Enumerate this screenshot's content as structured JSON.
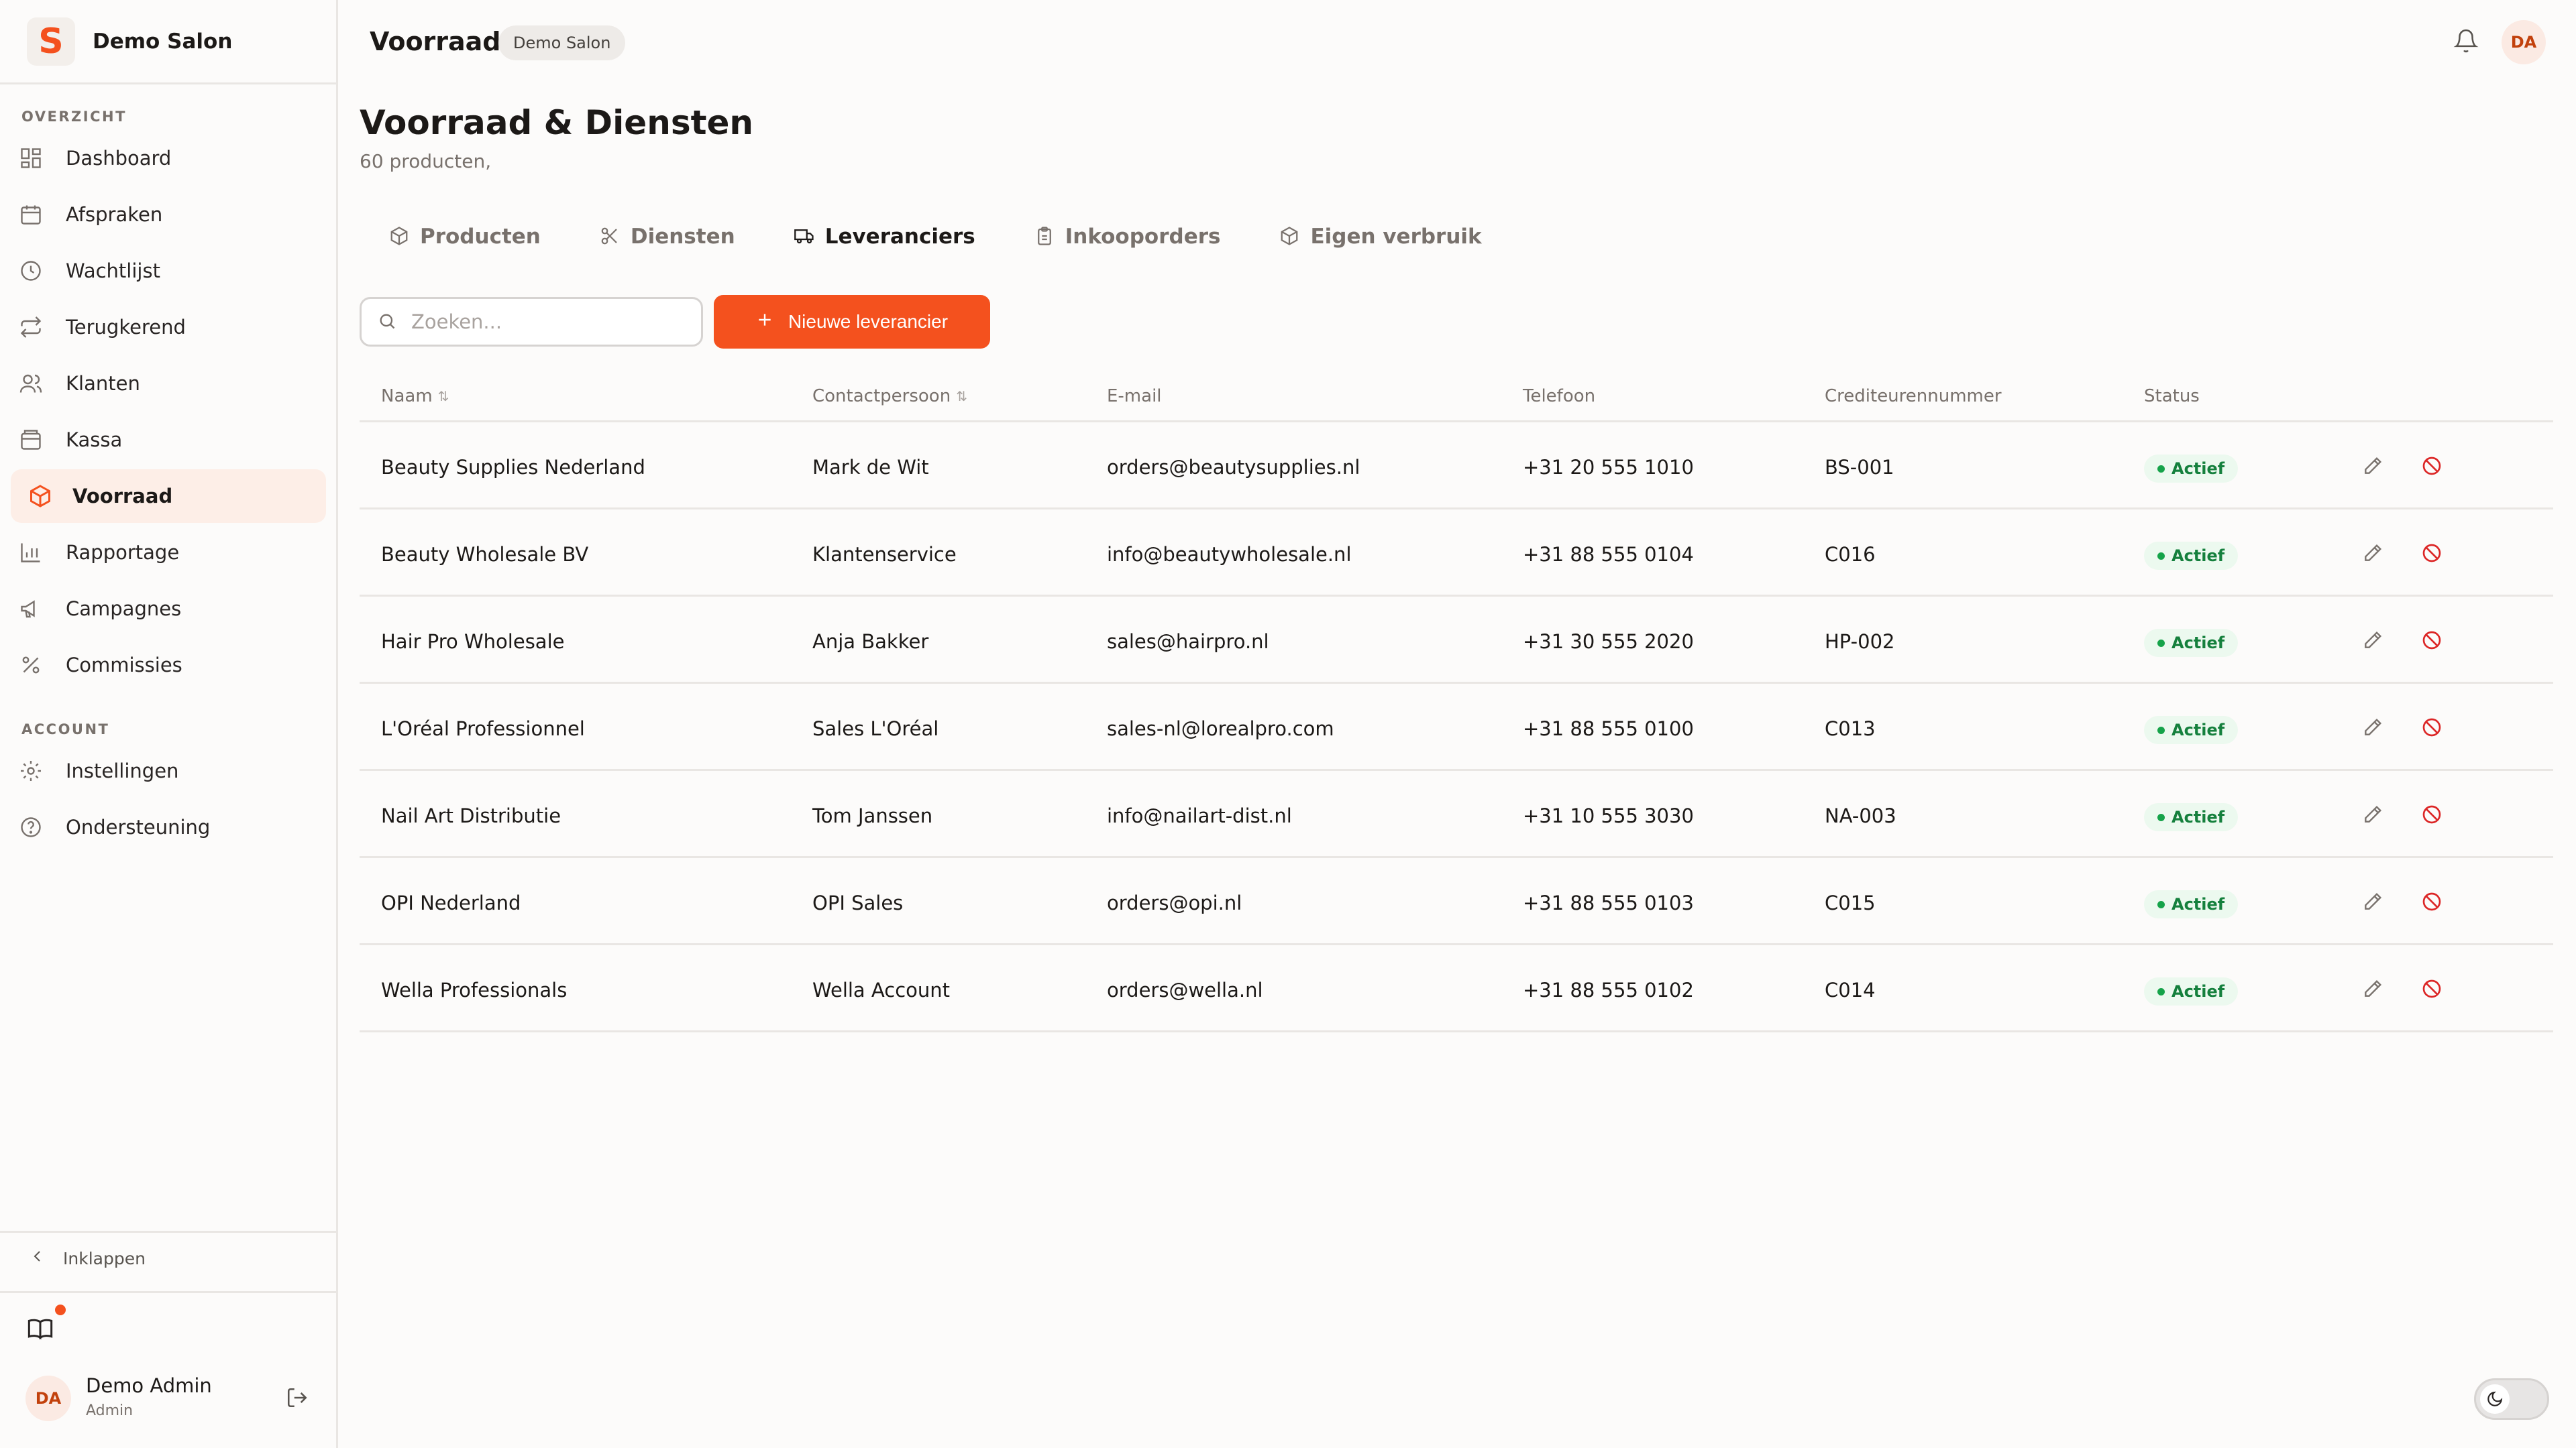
{
  "brand": {
    "logo_letter": "S",
    "name": "Demo Salon",
    "accent": "#f4511e"
  },
  "sidebar": {
    "section_overview": "OVERZICHT",
    "section_account": "ACCOUNT",
    "items": [
      {
        "label": "Dashboard",
        "icon": "dashboard-icon"
      },
      {
        "label": "Afspraken",
        "icon": "calendar-icon"
      },
      {
        "label": "Wachtlijst",
        "icon": "clock-icon"
      },
      {
        "label": "Terugkerend",
        "icon": "repeat-icon"
      },
      {
        "label": "Klanten",
        "icon": "users-icon"
      },
      {
        "label": "Kassa",
        "icon": "register-icon"
      },
      {
        "label": "Voorraad",
        "icon": "package-icon",
        "active": true
      },
      {
        "label": "Rapportage",
        "icon": "bar-chart-icon"
      },
      {
        "label": "Campagnes",
        "icon": "megaphone-icon"
      },
      {
        "label": "Commissies",
        "icon": "percent-icon"
      }
    ],
    "account_items": [
      {
        "label": "Instellingen",
        "icon": "gear-icon"
      },
      {
        "label": "Ondersteuning",
        "icon": "help-icon"
      }
    ],
    "collapse_label": "Inklappen",
    "user": {
      "initials": "DA",
      "name": "Demo Admin",
      "role": "Admin"
    }
  },
  "header": {
    "title": "Voorraad",
    "badge": "Demo Salon",
    "avatar_initials": "DA"
  },
  "page": {
    "title": "Voorraad & Diensten",
    "subtitle": "60 producten,"
  },
  "tabs": [
    {
      "label": "Producten",
      "icon": "box-icon"
    },
    {
      "label": "Diensten",
      "icon": "scissors-icon"
    },
    {
      "label": "Leveranciers",
      "icon": "truck-icon",
      "active": true
    },
    {
      "label": "Inkooporders",
      "icon": "clipboard-icon"
    },
    {
      "label": "Eigen verbruik",
      "icon": "box-icon"
    }
  ],
  "search": {
    "placeholder": "Zoeken...",
    "value": ""
  },
  "actions": {
    "new_supplier": "Nieuwe leverancier"
  },
  "table": {
    "columns": [
      "Naam",
      "Contactpersoon",
      "E-mail",
      "Telefoon",
      "Crediteurennummer",
      "Status"
    ],
    "rows": [
      {
        "name": "Beauty Supplies Nederland",
        "contact": "Mark de Wit",
        "email": "orders@beautysupplies.nl",
        "phone": "+31 20 555 1010",
        "creditor": "BS-001",
        "status": "Actief"
      },
      {
        "name": "Beauty Wholesale BV",
        "contact": "Klantenservice",
        "email": "info@beautywholesale.nl",
        "phone": "+31 88 555 0104",
        "creditor": "C016",
        "status": "Actief"
      },
      {
        "name": "Hair Pro Wholesale",
        "contact": "Anja Bakker",
        "email": "sales@hairpro.nl",
        "phone": "+31 30 555 2020",
        "creditor": "HP-002",
        "status": "Actief"
      },
      {
        "name": "L'Oréal Professionnel",
        "contact": "Sales L'Oréal",
        "email": "sales-nl@lorealpro.com",
        "phone": "+31 88 555 0100",
        "creditor": "C013",
        "status": "Actief"
      },
      {
        "name": "Nail Art Distributie",
        "contact": "Tom Janssen",
        "email": "info@nailart-dist.nl",
        "phone": "+31 10 555 3030",
        "creditor": "NA-003",
        "status": "Actief"
      },
      {
        "name": "OPI Nederland",
        "contact": "OPI Sales",
        "email": "orders@opi.nl",
        "phone": "+31 88 555 0103",
        "creditor": "C015",
        "status": "Actief"
      },
      {
        "name": "Wella Professionals",
        "contact": "Wella Account",
        "email": "orders@wella.nl",
        "phone": "+31 88 555 0102",
        "creditor": "C014",
        "status": "Actief"
      }
    ]
  }
}
